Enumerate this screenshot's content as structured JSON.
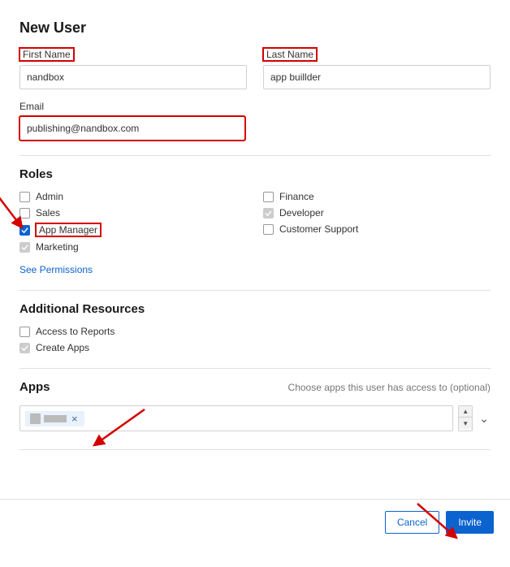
{
  "title": "New User",
  "fields": {
    "first_name_label": "First Name",
    "first_name_value": "nandbox",
    "last_name_label": "Last Name",
    "last_name_value": "app buillder",
    "email_label": "Email",
    "email_value": "publishing@nandbox.com"
  },
  "roles": {
    "heading": "Roles",
    "left": [
      {
        "label": "Admin",
        "checked": false,
        "disabled": false
      },
      {
        "label": "Sales",
        "checked": false,
        "disabled": false
      },
      {
        "label": "App Manager",
        "checked": true,
        "disabled": false
      },
      {
        "label": "Marketing",
        "checked": true,
        "disabled": true
      }
    ],
    "right": [
      {
        "label": "Finance",
        "checked": false,
        "disabled": false
      },
      {
        "label": "Developer",
        "checked": true,
        "disabled": true
      },
      {
        "label": "Customer Support",
        "checked": false,
        "disabled": false
      }
    ]
  },
  "see_permissions": "See Permissions",
  "additional": {
    "heading": "Additional Resources",
    "items": [
      {
        "label": "Access to Reports",
        "checked": false,
        "disabled": false
      },
      {
        "label": "Create Apps",
        "checked": true,
        "disabled": true
      }
    ]
  },
  "apps": {
    "heading": "Apps",
    "hint": "Choose apps this user has access to (optional)",
    "tag_remove": "×"
  },
  "buttons": {
    "cancel": "Cancel",
    "invite": "Invite"
  }
}
